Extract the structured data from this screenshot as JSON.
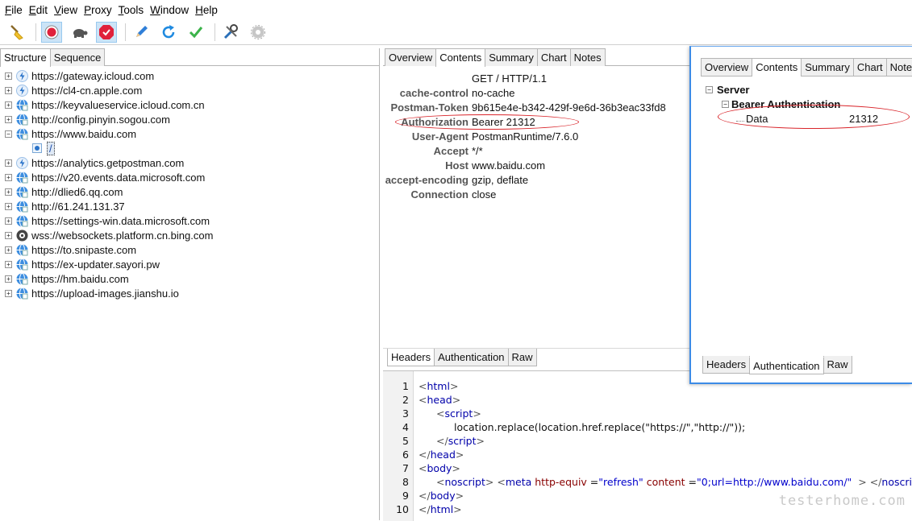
{
  "menu": [
    {
      "u": "F",
      "rest": "ile"
    },
    {
      "u": "E",
      "rest": "dit"
    },
    {
      "u": "V",
      "rest": "iew"
    },
    {
      "u": "P",
      "rest": "roxy"
    },
    {
      "u": "T",
      "rest": "ools"
    },
    {
      "u": "W",
      "rest": "indow"
    },
    {
      "u": "H",
      "rest": "elp"
    }
  ],
  "left_tabs": [
    "Structure",
    "Sequence"
  ],
  "hosts": [
    {
      "label": "https://gateway.icloud.com",
      "expander": "+",
      "icon": "bolt-icon"
    },
    {
      "label": "https://cl4-cn.apple.com",
      "expander": "+",
      "icon": "bolt-icon"
    },
    {
      "label": "https://keyvalueservice.icloud.com.cn",
      "expander": "+",
      "icon": "globe-icon"
    },
    {
      "label": "http://config.pinyin.sogou.com",
      "expander": "+",
      "icon": "globe-icon"
    },
    {
      "label": "https://www.baidu.com",
      "expander": "−",
      "icon": "globe-icon"
    },
    {
      "label": "https://analytics.getpostman.com",
      "expander": "+",
      "icon": "bolt-icon"
    },
    {
      "label": "https://v20.events.data.microsoft.com",
      "expander": "+",
      "icon": "globe-icon"
    },
    {
      "label": "http://dlied6.qq.com",
      "expander": "+",
      "icon": "globe-icon"
    },
    {
      "label": "http://61.241.131.37",
      "expander": "+",
      "icon": "globe-icon"
    },
    {
      "label": "https://settings-win.data.microsoft.com",
      "expander": "+",
      "icon": "globe-icon"
    },
    {
      "label": "wss://websockets.platform.cn.bing.com",
      "expander": "+",
      "icon": "socket-icon"
    },
    {
      "label": "https://to.snipaste.com",
      "expander": "+",
      "icon": "globe-icon"
    },
    {
      "label": "https://ex-updater.sayori.pw",
      "expander": "+",
      "icon": "globe-icon"
    },
    {
      "label": "https://hm.baidu.com",
      "expander": "+",
      "icon": "globe-icon"
    },
    {
      "label": "https://upload-images.jianshu.io",
      "expander": "+",
      "icon": "globe-icon"
    }
  ],
  "child_path": "/",
  "mid_tabs": [
    "Overview",
    "Contents",
    "Summary",
    "Chart",
    "Notes"
  ],
  "request_line": "GET / HTTP/1.1",
  "headers": [
    {
      "key": "cache-control",
      "value": "no-cache"
    },
    {
      "key": "Postman-Token",
      "value": "9b615e4e-b342-429f-9e6d-36b3eac33fd8"
    },
    {
      "key": "Authorization",
      "value": "Bearer 21312"
    },
    {
      "key": "User-Agent",
      "value": "PostmanRuntime/7.6.0"
    },
    {
      "key": "Accept",
      "value": "*/*"
    },
    {
      "key": "Host",
      "value": "www.baidu.com"
    },
    {
      "key": "accept-encoding",
      "value": "gzip, deflate"
    },
    {
      "key": "Connection",
      "value": "close"
    }
  ],
  "request_bottom_tabs": [
    "Headers",
    "Authentication",
    "Raw"
  ],
  "code_lines": [
    {
      "n": "1",
      "indent": 0,
      "parts": [
        [
          "br",
          "<"
        ],
        [
          "tag",
          "html"
        ],
        [
          "br",
          ">"
        ]
      ]
    },
    {
      "n": "2",
      "indent": 0,
      "parts": [
        [
          "br",
          "<"
        ],
        [
          "tag",
          "head"
        ],
        [
          "br",
          ">"
        ]
      ]
    },
    {
      "n": "3",
      "indent": 1,
      "parts": [
        [
          "br",
          "<"
        ],
        [
          "tag",
          "script"
        ],
        [
          "br",
          ">"
        ]
      ]
    },
    {
      "n": "4",
      "indent": 2,
      "parts": [
        [
          "plain",
          "location.replace(location.href.replace(\"https://\",\"http://\"));"
        ]
      ]
    },
    {
      "n": "5",
      "indent": 1,
      "parts": [
        [
          "br",
          "</"
        ],
        [
          "tag",
          "script"
        ],
        [
          "br",
          ">"
        ]
      ]
    },
    {
      "n": "6",
      "indent": 0,
      "parts": [
        [
          "br",
          "</"
        ],
        [
          "tag",
          "head"
        ],
        [
          "br",
          ">"
        ]
      ]
    },
    {
      "n": "7",
      "indent": 0,
      "parts": [
        [
          "br",
          "<"
        ],
        [
          "tag",
          "body"
        ],
        [
          "br",
          ">"
        ]
      ]
    },
    {
      "n": "8",
      "indent": 1,
      "parts": [
        [
          "br",
          "<"
        ],
        [
          "tag",
          "noscript"
        ],
        [
          "br",
          ">"
        ],
        [
          "br",
          " <"
        ],
        [
          "tag",
          "meta"
        ],
        [
          "attr",
          " http-equiv"
        ],
        [
          "plain",
          " ="
        ],
        [
          "str",
          "\"refresh\""
        ],
        [
          "attr",
          " content"
        ],
        [
          "plain",
          " ="
        ],
        [
          "str",
          "\"0;url=http://www.baidu.com/\""
        ],
        [
          "plain",
          "  "
        ],
        [
          "br",
          "> </"
        ],
        [
          "tag",
          "noscript"
        ],
        [
          "br",
          ">"
        ]
      ]
    },
    {
      "n": "9",
      "indent": 0,
      "parts": [
        [
          "br",
          "</"
        ],
        [
          "tag",
          "body"
        ],
        [
          "br",
          ">"
        ]
      ]
    },
    {
      "n": "10",
      "indent": 0,
      "parts": [
        [
          "br",
          "</"
        ],
        [
          "tag",
          "html"
        ],
        [
          "br",
          ">"
        ]
      ]
    }
  ],
  "float_window": {
    "tabs": [
      "Overview",
      "Contents",
      "Summary",
      "Chart",
      "Note"
    ],
    "server_label": "Server",
    "auth_label": "Bearer Authentication",
    "data_key": "Data",
    "data_value": "21312",
    "bottom_tabs": [
      "Headers",
      "Authentication",
      "Raw"
    ]
  },
  "watermark": "testerhome.com",
  "colors": {
    "annotation_red": "#d9252b",
    "window_border": "#3c8be6"
  }
}
